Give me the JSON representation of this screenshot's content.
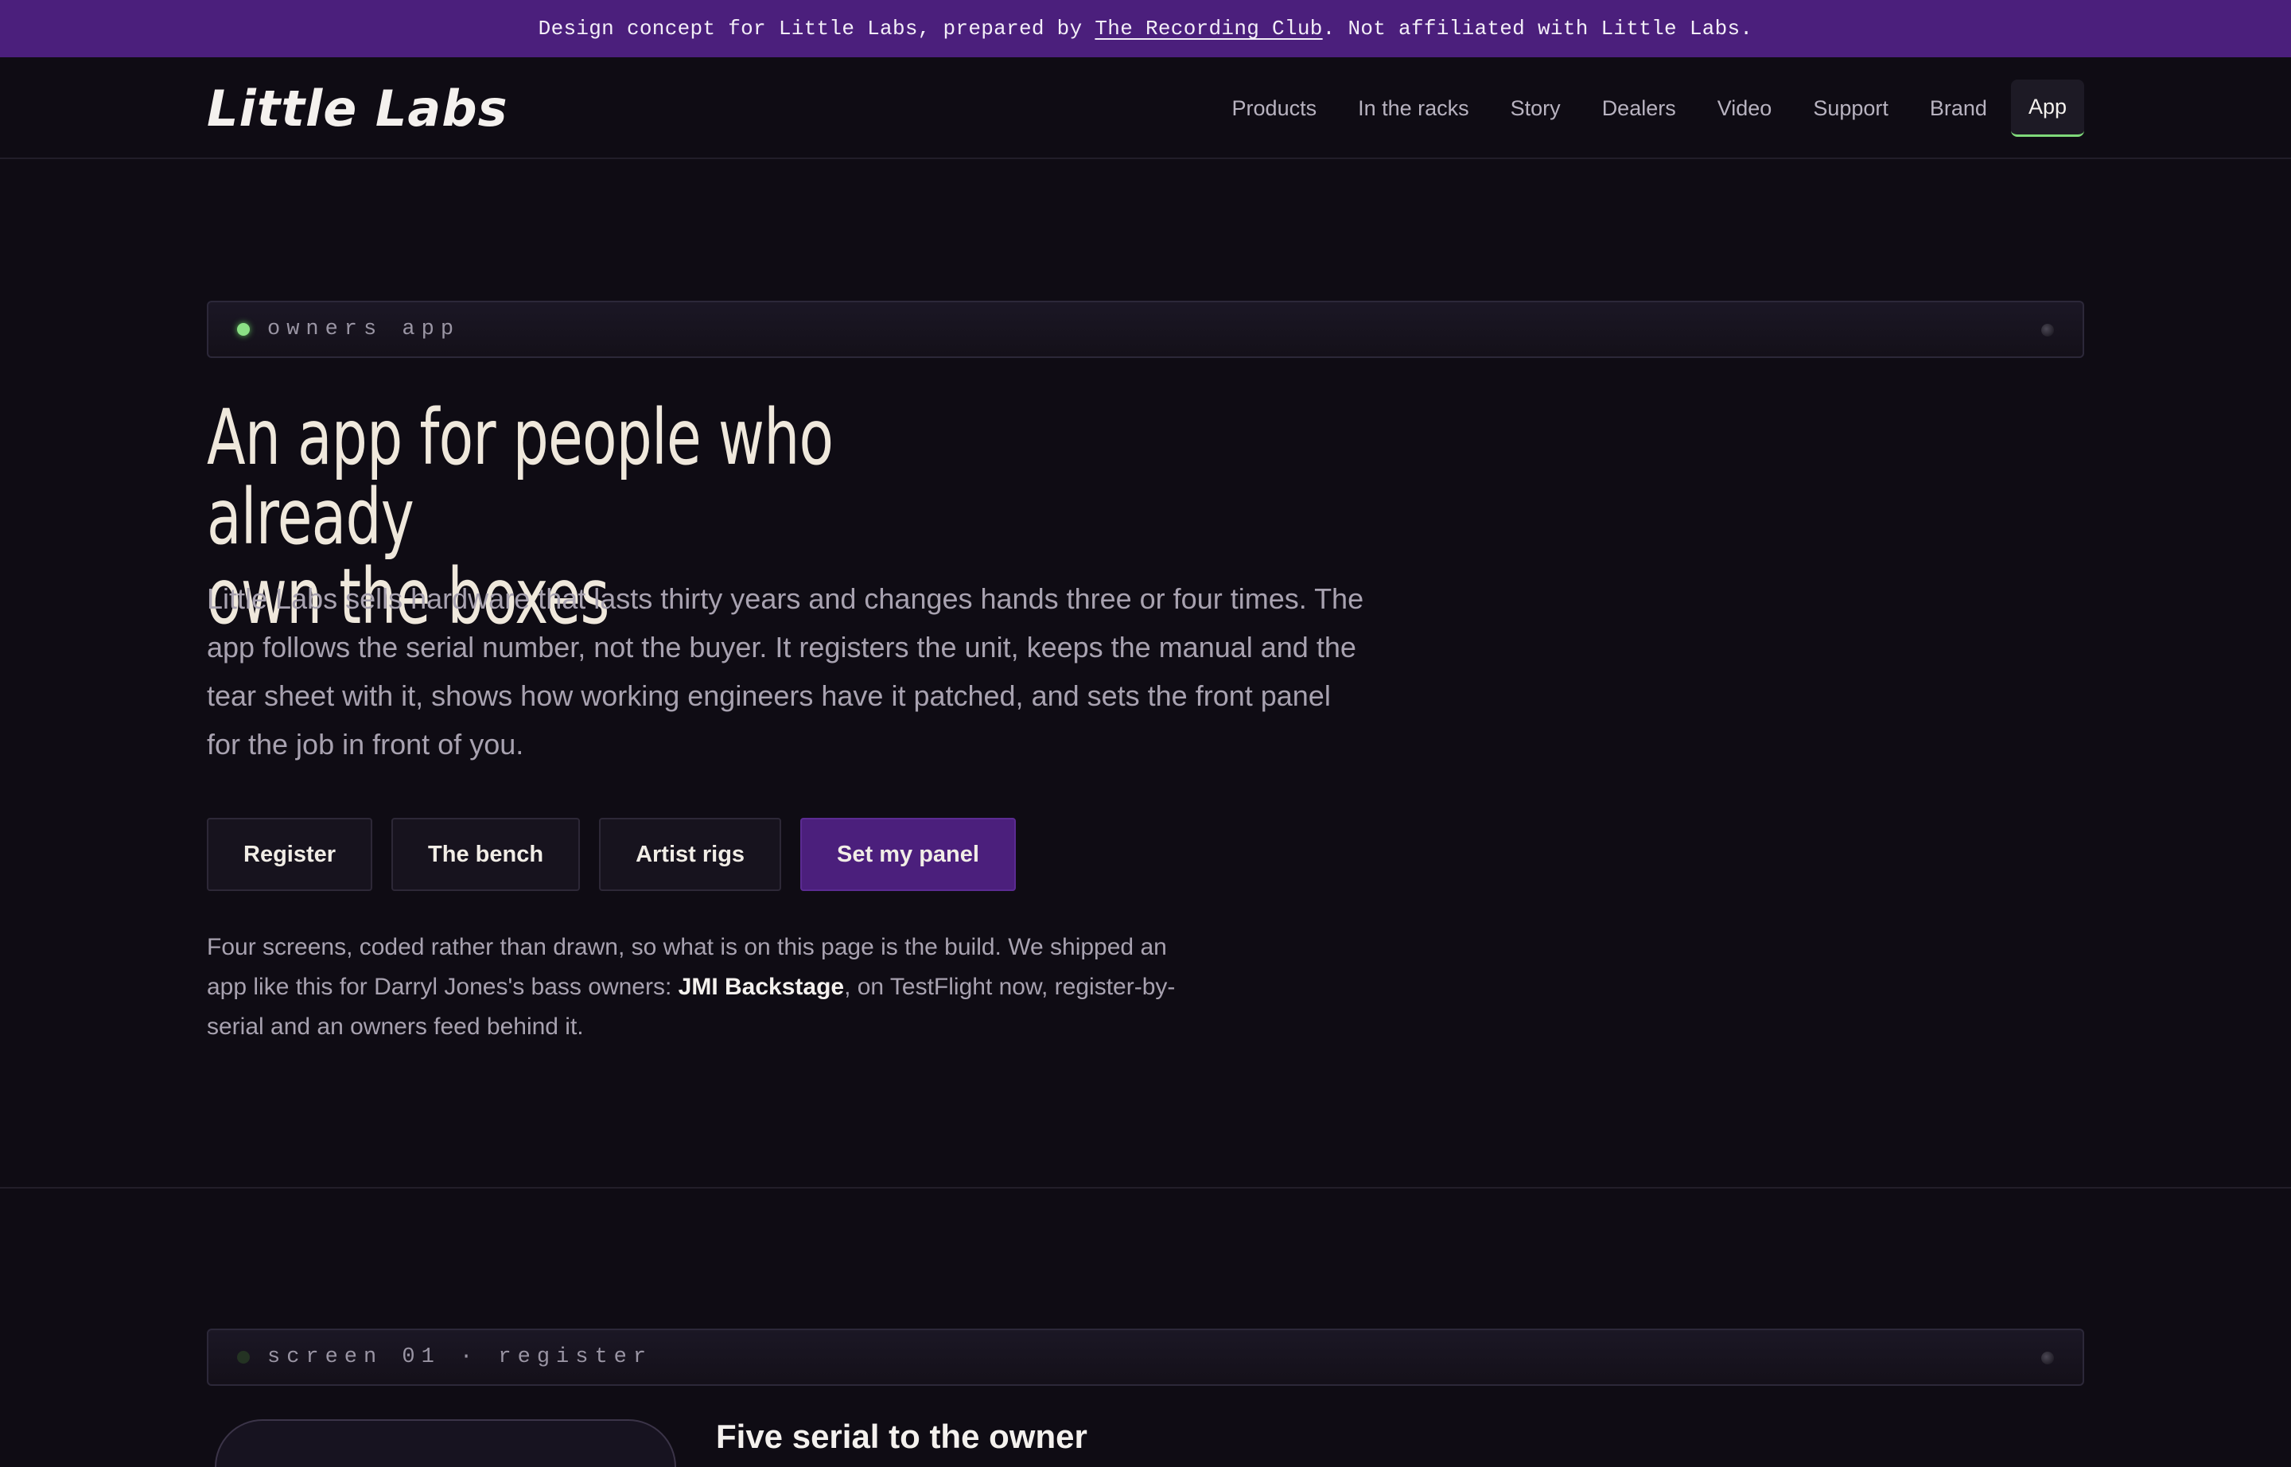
{
  "banner": {
    "prefix": "Design concept for Little Labs, prepared by ",
    "link": "The Recording Club",
    "suffix": ". Not affiliated with Little Labs."
  },
  "nav": {
    "logo": "Little Labs",
    "items": [
      "Products",
      "In the racks",
      "Story",
      "Dealers",
      "Video",
      "Support",
      "Brand",
      "App"
    ],
    "active": "App"
  },
  "hero": {
    "panel_label": "owners app",
    "headline_1": "An app for people who already",
    "headline_2": "own the boxes",
    "lede": "Little Labs sells hardware that lasts thirty years and changes hands three or four times. The app follows the serial number, not the buyer. It registers the unit, keeps the manual and the tear sheet with it, shows how working engineers have it patched, and sets the front panel for the job in front of you.",
    "buttons": [
      "Register",
      "The bench",
      "Artist rigs",
      "Set my panel"
    ],
    "note_before": "Four screens, coded rather than drawn, so what is on this page is the build. We shipped an app like this for Darryl Jones's bass owners: ",
    "note_strong": "JMI Backstage",
    "note_after": ", on TestFlight now, register-by-serial and an owners feed behind it."
  },
  "screen1": {
    "panel_label": "screen 01 · register",
    "heading": "Five serial to the owner"
  },
  "colors": {
    "banner": "#4b1f7c",
    "background": "#0f0c14",
    "accent_green": "#8be085",
    "headline": "#efe8dc"
  }
}
